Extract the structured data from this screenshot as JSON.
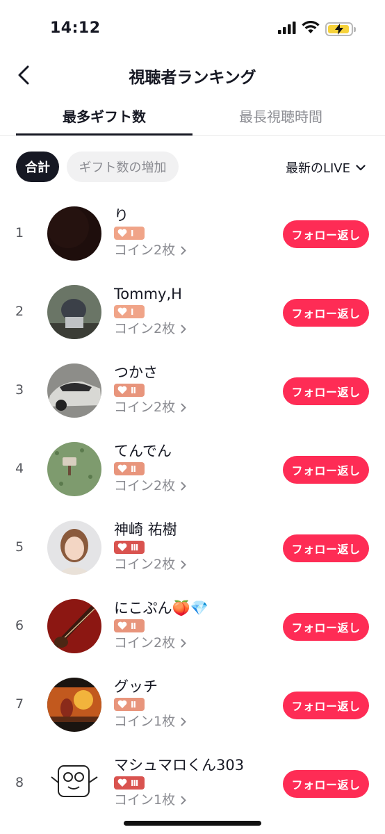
{
  "status_bar": {
    "time": "14:12",
    "battery_color": "#f6d23b"
  },
  "header": {
    "title": "視聴者ランキング"
  },
  "tabs": [
    {
      "label": "最多ギフト数",
      "active": true
    },
    {
      "label": "最長視聴時間",
      "active": false
    }
  ],
  "filters": {
    "total_label": "合計",
    "increase_label": "ギフト数の増加",
    "live_select": "最新のLIVE"
  },
  "colors": {
    "accent": "#fe2c55",
    "badge_orange": "#f0a488",
    "badge_red": "#d9534f"
  },
  "rows": [
    {
      "rank": "1",
      "name": "り",
      "level": "I",
      "coins": "コイン2枚",
      "follow": "フォロー返し"
    },
    {
      "rank": "2",
      "name": "Tommy,H",
      "level": "I",
      "coins": "コイン2枚",
      "follow": "フォロー返し"
    },
    {
      "rank": "3",
      "name": "つかさ",
      "level": "II",
      "coins": "コイン2枚",
      "follow": "フォロー返し"
    },
    {
      "rank": "4",
      "name": "てんでん",
      "level": "II",
      "coins": "コイン2枚",
      "follow": "フォロー返し"
    },
    {
      "rank": "5",
      "name": "神崎 祐樹",
      "level": "III",
      "coins": "コイン2枚",
      "follow": "フォロー返し"
    },
    {
      "rank": "6",
      "name": "にこぷん🍑💎",
      "level": "II",
      "coins": "コイン2枚",
      "follow": "フォロー返し"
    },
    {
      "rank": "7",
      "name": "グッチ",
      "level": "II",
      "coins": "コイン1枚",
      "follow": "フォロー返し"
    },
    {
      "rank": "8",
      "name": "マシュマロくん303",
      "level": "III",
      "coins": "コイン1枚",
      "follow": "フォロー返し"
    }
  ]
}
